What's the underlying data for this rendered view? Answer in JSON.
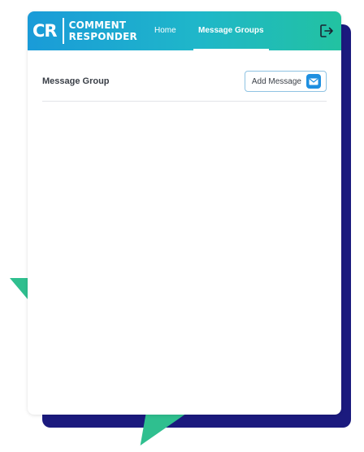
{
  "logo": {
    "mark": "CR",
    "line1": "COMMENT",
    "line2": "RESPONDER"
  },
  "nav": {
    "home_label": "Home",
    "groups_label": "Message Groups",
    "active": "Message Groups"
  },
  "page": {
    "title": "Message Group",
    "add_button_label": "Add Message"
  },
  "icons": {
    "logout": "logout-icon",
    "add": "envelope-icon"
  },
  "colors": {
    "nav_start": "#1a9bd8",
    "nav_end": "#22c2a1",
    "accent_dark": "#1b1a7e",
    "accent_green": "#2fbf8f"
  }
}
